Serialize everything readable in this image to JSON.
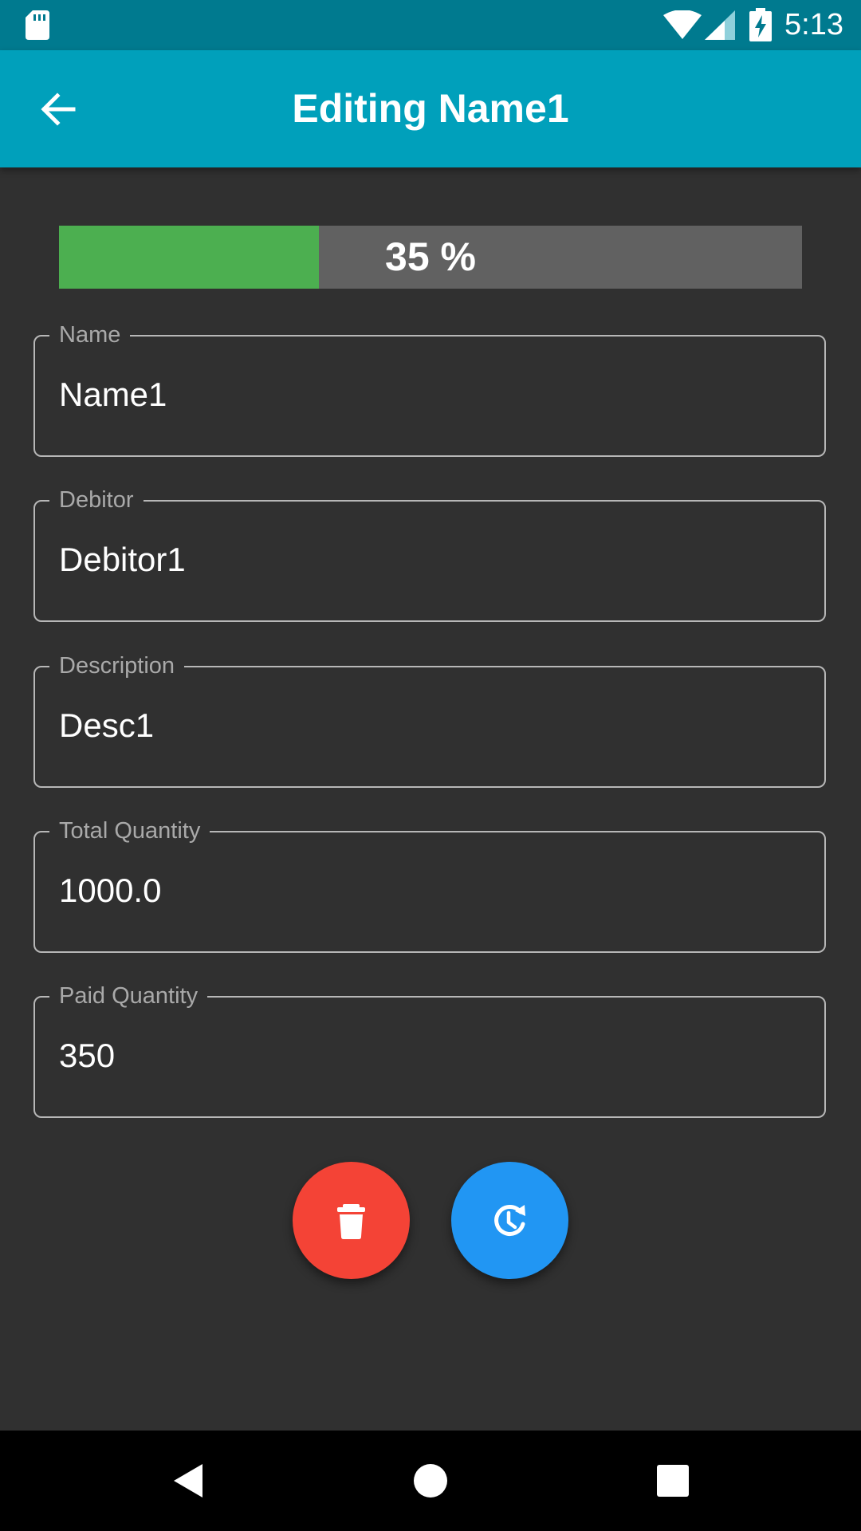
{
  "status_bar": {
    "time": "5:13",
    "icons": [
      "sd-card-icon",
      "wifi-icon",
      "cell-signal-icon",
      "battery-charging-icon"
    ]
  },
  "app_bar": {
    "title": "Editing Name1",
    "back_icon": "arrow-back-icon"
  },
  "progress": {
    "percent": 35,
    "label": "35 %",
    "fill_color": "#4caf50",
    "track_color": "#616161"
  },
  "fields": {
    "name": {
      "label": "Name",
      "value": "Name1"
    },
    "debitor": {
      "label": "Debitor",
      "value": "Debitor1"
    },
    "description": {
      "label": "Description",
      "value": "Desc1"
    },
    "total_quantity": {
      "label": "Total Quantity",
      "value": "1000.0"
    },
    "paid_quantity": {
      "label": "Paid Quantity",
      "value": "350"
    }
  },
  "actions": {
    "delete": {
      "icon": "trash-icon",
      "color": "#f44336"
    },
    "restore": {
      "icon": "restore-clock-icon",
      "color": "#2196f3"
    }
  },
  "nav_bar": {
    "icons": [
      "back-triangle-icon",
      "home-circle-icon",
      "recents-square-icon"
    ]
  },
  "colors": {
    "background": "#303030",
    "app_bar": "#00a0bb",
    "status_bar": "#007a8f"
  }
}
